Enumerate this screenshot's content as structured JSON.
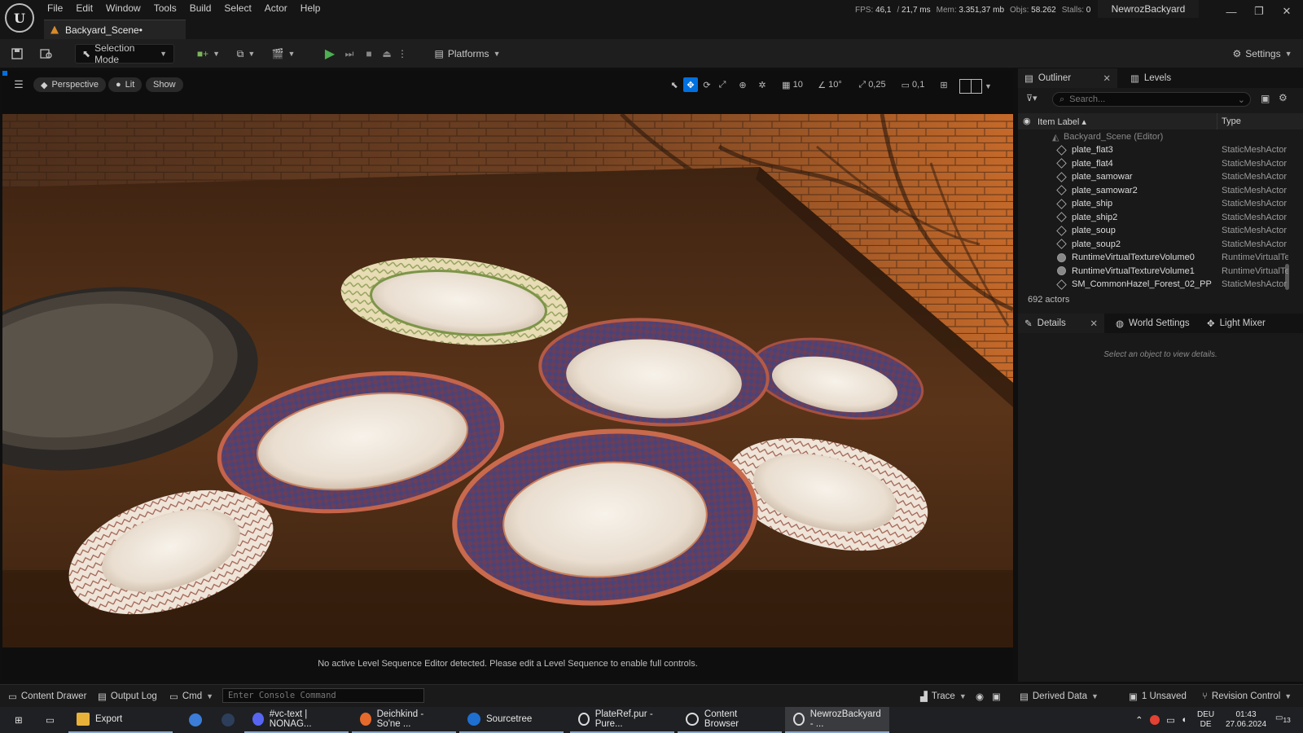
{
  "menu": [
    "File",
    "Edit",
    "Window",
    "Tools",
    "Build",
    "Select",
    "Actor",
    "Help"
  ],
  "document_tab": "Backyard_Scene•",
  "stats": [
    {
      "label": "FPS:",
      "value": "46,1"
    },
    {
      "label": "/",
      "value": "21,7 ms"
    },
    {
      "label": "Mem:",
      "value": "3.351,37 mb"
    },
    {
      "label": "Objs:",
      "value": "58.262"
    },
    {
      "label": "Stalls:",
      "value": "0"
    }
  ],
  "project_name": "NewrozBackyard",
  "toolbar": {
    "selection_mode": "Selection Mode",
    "platforms": "Platforms",
    "settings": "Settings"
  },
  "viewport": {
    "perspective": "Perspective",
    "lit": "Lit",
    "show": "Show",
    "grid_snap": "10",
    "rotation_snap": "10°",
    "scale_snap": "0,25",
    "camera_speed": "0,1",
    "sequence_msg": "No active Level Sequence Editor detected. Please edit a Level Sequence to enable full controls."
  },
  "outliner": {
    "tab": "Outliner",
    "levels_tab": "Levels",
    "search_placeholder": "Search...",
    "col_label": "Item Label",
    "col_type": "Type",
    "root": "Backyard_Scene (Editor)",
    "rows": [
      {
        "label": "plate_flat3",
        "type": "StaticMeshActor"
      },
      {
        "label": "plate_flat4",
        "type": "StaticMeshActor"
      },
      {
        "label": "plate_samowar",
        "type": "StaticMeshActor"
      },
      {
        "label": "plate_samowar2",
        "type": "StaticMeshActor"
      },
      {
        "label": "plate_ship",
        "type": "StaticMeshActor"
      },
      {
        "label": "plate_ship2",
        "type": "StaticMeshActor"
      },
      {
        "label": "plate_soup",
        "type": "StaticMeshActor"
      },
      {
        "label": "plate_soup2",
        "type": "StaticMeshActor"
      },
      {
        "label": "RuntimeVirtualTextureVolume0",
        "type": "RuntimeVirtualTe"
      },
      {
        "label": "RuntimeVirtualTextureVolume1",
        "type": "RuntimeVirtualTe"
      },
      {
        "label": "SM_CommonHazel_Forest_02_PP",
        "type": "StaticMeshActor"
      }
    ],
    "actor_count": "692 actors"
  },
  "details": {
    "tab": "Details",
    "world_settings": "World Settings",
    "light_mixer": "Light Mixer",
    "empty_msg": "Select an object to view details."
  },
  "statusbar": {
    "content_drawer": "Content Drawer",
    "output_log": "Output Log",
    "cmd": "Cmd",
    "console_placeholder": "Enter Console Command",
    "trace": "Trace",
    "derived_data": "Derived Data",
    "unsaved": "1 Unsaved",
    "revision_control": "Revision Control"
  },
  "taskbar": {
    "items": [
      "Export",
      "#vc-text | NONAG...",
      "Deichkind - So'ne ...",
      "Sourcetree",
      "PlateRef.pur - Pure...",
      "Content Browser",
      "NewrozBackyard - ..."
    ],
    "lang_top": "DEU",
    "lang_bottom": "DE",
    "time": "01:43",
    "date": "27.06.2024",
    "notifications": "13"
  },
  "colors": {
    "accent": "#0070e0",
    "play": "#4caf50",
    "brand_orange": "#d68a2c"
  }
}
